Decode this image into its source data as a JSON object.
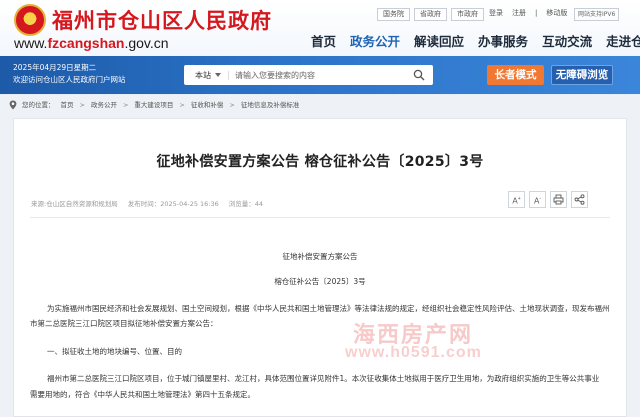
{
  "header": {
    "site_title": "福州市仓山区人民政府",
    "domain_prefix": "www.",
    "domain_brand": "fzcangshan",
    "domain_suffix": ".gov.cn",
    "top_links": [
      "国务院",
      "省政府",
      "市政府"
    ],
    "util_links": [
      "登录",
      "注册",
      "|",
      "移动版"
    ],
    "ipv6_badge": "网站支持IPV6",
    "nav": [
      "首页",
      "政务公开",
      "解读回应",
      "办事服务",
      "互动交流",
      "走进仓山"
    ],
    "nav_active": "政务公开"
  },
  "banner": {
    "date_line": "2025年04月29日星期二",
    "welcome_line": "欢迎访问仓山区人民政府门户网站",
    "search_scope": "本站",
    "search_placeholder": "请输入您要搜索的内容",
    "elder_mode": "长者模式",
    "accessibility": "无障碍浏览"
  },
  "breadcrumb": {
    "prefix": "您的位置：",
    "items": [
      "首页",
      "政务公开",
      "重大建设项目",
      "征收和补偿",
      "征地信息及补偿标准"
    ]
  },
  "article": {
    "title": "征地补偿安置方案公告 榕仓征补公告〔2025〕3号",
    "source": "来源:仓山区自然资源和规划局",
    "publish_time": "发布时间：2025-04-25 16:36",
    "views": "浏览量：44",
    "tools": [
      "A+",
      "A-",
      "print",
      "share"
    ],
    "doc_title": "征地补偿安置方案公告",
    "doc_number": "榕仓征补公告〔2025〕3号",
    "para1_line1": "为实施福州市国民经济和社会发展规划、国土空间规划，根据《中华人民共和国土地管理法》等法律法规的规定，经组织社会稳定性风险评估、土地现状调查，现发布福州",
    "para1_line2": "市第二总医院三江口院区项目拟征地补偿安置方案公告：",
    "section1": "一、拟征收土地的地块编号、位置、目的",
    "para3_line1": "福州市第二总医院三江口院区项目，位于城门镇屋里村、龙江村，具体范围位置详见附件1。本次征收集体土地拟用于医疗卫生用地，为政府组织实施的卫生等公共事业",
    "para3_line2": "需要用地的，符合《中华人民共和国土地管理法》第四十五条规定。"
  },
  "watermark": {
    "logo": "海西房产网",
    "url": "www.h0591.com"
  },
  "colors": {
    "brand_red": "#d5171e",
    "nav_blue": "#1f64b4",
    "banner_blue": "#2c74c9",
    "elder_orange": "#f17832"
  }
}
